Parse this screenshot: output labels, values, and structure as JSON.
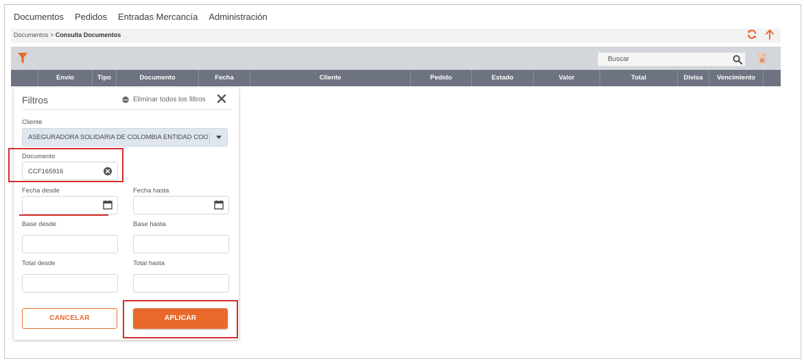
{
  "nav": {
    "items": [
      "Documentos",
      "Pedidos",
      "Entradas Mercancía",
      "Administración"
    ]
  },
  "breadcrumb": {
    "parent": "Documentos >",
    "current": "Consulta Documentos"
  },
  "toolbar": {
    "search_placeholder": "Buscar",
    "icons": [
      "filter-icon",
      "search-icon",
      "excel-export-icon",
      "refresh-icon",
      "arrow-up-icon"
    ]
  },
  "table": {
    "columns": [
      "Envío",
      "Tipo",
      "Documento",
      "Fecha",
      "Cliente",
      "Pedido",
      "Estado",
      "Valor",
      "Total",
      "Divisa",
      "Vencimiento"
    ]
  },
  "filters": {
    "title": "Filtros",
    "clear_all_label": "Eliminar todos los filtros",
    "cliente_label": "Cliente",
    "cliente_value": "ASEGURADORA SOLIDARIA DE COLOMBIA ENTIDAD COOP",
    "documento_label": "Documento",
    "documento_value": "CCF165916",
    "fecha_desde_label": "Fecha desde",
    "fecha_hasta_label": "Fecha hasta",
    "base_desde_label": "Base desde",
    "base_hasta_label": "Base hasta",
    "total_desde_label": "Total desde",
    "total_hasta_label": "Total hasta",
    "cancel_label": "CANCELAR",
    "apply_label": "APLICAR"
  },
  "colors": {
    "accent": "#e8692b",
    "table_header": "#6d7381",
    "toolbar": "#d3d6db",
    "highlight": "#d52b2b"
  }
}
